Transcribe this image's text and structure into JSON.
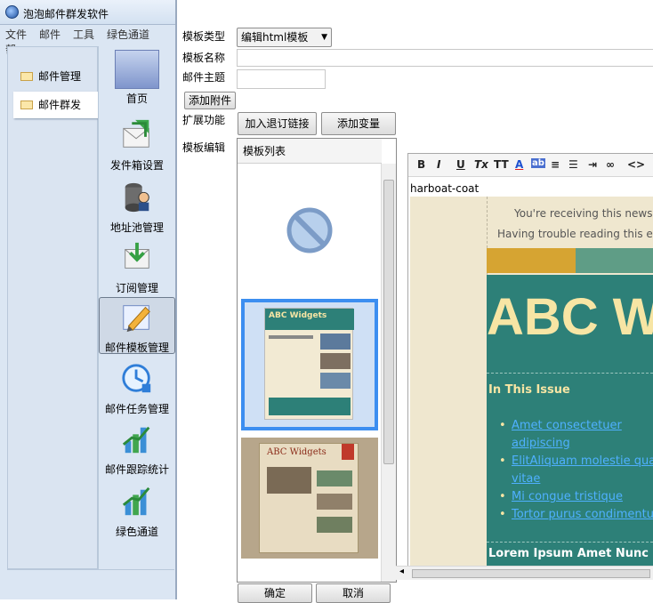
{
  "app": {
    "title": "泡泡邮件群发软件",
    "menu": [
      "文件",
      "邮件",
      "工具",
      "绿色通道",
      "帮"
    ]
  },
  "left_nav": [
    {
      "label": "邮件管理",
      "selected": false
    },
    {
      "label": "邮件群发",
      "selected": true
    }
  ],
  "tiles": [
    {
      "label": "首页",
      "icon": "home-icon"
    },
    {
      "label": "发件箱设置",
      "icon": "outbox-icon"
    },
    {
      "label": "地址池管理",
      "icon": "address-pool-icon"
    },
    {
      "label": "订阅管理",
      "icon": "subscription-icon"
    },
    {
      "label": "邮件模板管理",
      "icon": "template-icon",
      "selected": true
    },
    {
      "label": "邮件任务管理",
      "icon": "task-icon"
    },
    {
      "label": "邮件跟踪统计",
      "icon": "stats-icon"
    },
    {
      "label": "绿色通道",
      "icon": "green-channel-icon"
    }
  ],
  "dialog": {
    "template_type_label": "模板类型",
    "template_type_value": "编辑html模板",
    "template_name_label": "模板名称",
    "template_name_value": "",
    "subject_label": "邮件主题",
    "subject_value": "",
    "add_attachment": "添加附件",
    "extensions_label": "扩展功能",
    "add_unsubscribe": "加入退订链接",
    "add_variable": "添加变量",
    "editor_label": "模板编辑",
    "list_header": "模板列表",
    "ok": "确定",
    "cancel": "取消"
  },
  "editor": {
    "toolbar": [
      "B",
      "I",
      "U",
      "Tx",
      "TT",
      "A",
      "ab",
      "align-left-icon",
      "list-icon",
      "indent-icon",
      "link-icon",
      "<>"
    ],
    "filename": "harboat-coat",
    "notice1": "You're receiving this newslet",
    "notice2": "Having trouble reading this ema",
    "banner": "ABC W",
    "issue_title": "In This Issue",
    "links": [
      "Amet consectetuer",
      "adipiscing",
      "ElitAliquam molestie qua",
      "vitae",
      "Mi congue tristique",
      "Tortor purus condimentum"
    ],
    "footer_heading": "Lorem Ipsum Amet Nunc Rh"
  },
  "thumbs": [
    {
      "title": "ABC Widgets",
      "selected": true
    },
    {
      "title": "ABC Widgets",
      "selected": false
    }
  ],
  "colors": {
    "teal": "#2d8078",
    "gold": "#d6a432",
    "cream": "#f0e9d2",
    "link": "#4fb0ff",
    "banner_text": "#f7e5a4"
  }
}
